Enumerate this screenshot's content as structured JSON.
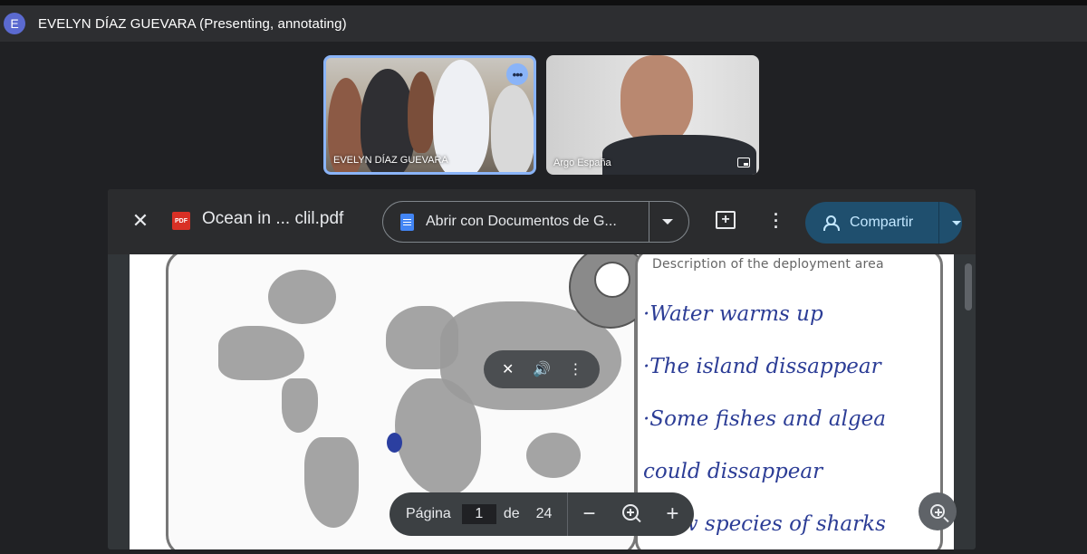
{
  "meeting": {
    "presenter_initial": "E",
    "presenter_title": "EVELYN DÍAZ GUEVARA (Presenting, annotating)"
  },
  "tiles": [
    {
      "label": "EVELYN DÍAZ GUEVARA",
      "more_icon": "more-horiz-icon",
      "active": true
    },
    {
      "label": "Argo España",
      "icon": "picture-in-picture-icon",
      "active": false
    }
  ],
  "viewer": {
    "close_icon": "close-icon",
    "file_icon": "pdf-icon",
    "file_icon_text": "PDF",
    "filename": "Ocean in ... clil.pdf",
    "open_with_label": "Abrir con Documentos de G...",
    "share_label": "Compartir",
    "colors": {
      "share_bg": "#1f4f6e",
      "share_text": "#c2e7ff",
      "pdf_red": "#d93025",
      "docs_blue": "#4285f4"
    }
  },
  "document": {
    "notes_heading": "Description of the deployment area",
    "notes": [
      "·Water warms up",
      "·The island dissappear",
      "·Some fishes and algea",
      "could dissappear",
      "·New species of sharks"
    ],
    "annotation_color": "#2b3fa0"
  },
  "pager": {
    "page_label": "Página",
    "current_page": "1",
    "of_label": "de",
    "total_pages": "24",
    "zoom_out": "−",
    "zoom_in": "+"
  }
}
